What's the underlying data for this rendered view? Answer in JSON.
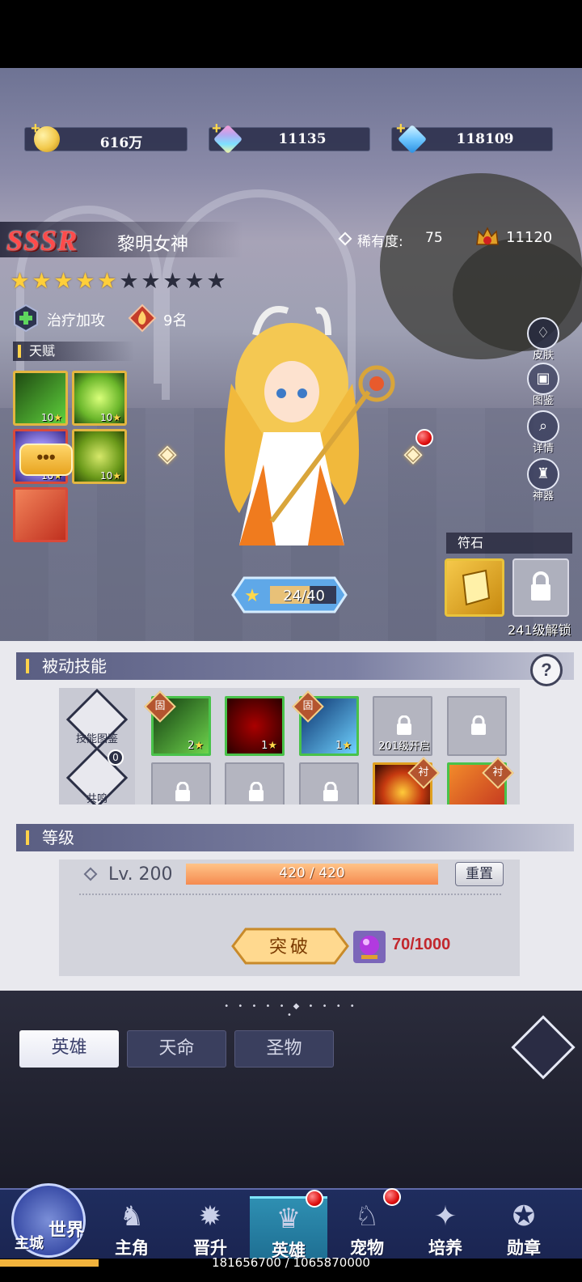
{
  "resources": [
    {
      "name": "gold",
      "value": "616万",
      "color": "#f2c94c"
    },
    {
      "name": "rainbow-diamond",
      "value": "11135",
      "color": "#b9a6f0"
    },
    {
      "name": "blue-diamond",
      "value": "118109",
      "color": "#6fc7ff"
    }
  ],
  "hero": {
    "rarity": "SSSR",
    "name": "黎明女神",
    "rarity_label": "稀有度:",
    "rarity_value": "75",
    "power": "11120",
    "stars_total": 10,
    "stars_filled": 5,
    "type": "治疗加攻",
    "count": "9名"
  },
  "talent": {
    "title": "天赋",
    "items": [
      {
        "level": "10",
        "icon": "green-vine-icon"
      },
      {
        "level": "10",
        "icon": "green-vortex-icon"
      },
      {
        "level": "10",
        "icon": "purple-swirl-icon"
      },
      {
        "level": "10",
        "icon": "green-dragon-icon"
      },
      {
        "level": "",
        "icon": "red-fist-icon"
      }
    ],
    "chat": "•••"
  },
  "side_menu": [
    "皮肤",
    "图鉴",
    "详情",
    "神器"
  ],
  "runes": {
    "title": "符石",
    "unlock": "241级解锁"
  },
  "progress": {
    "text": "24/40",
    "current": 24,
    "max": 40
  },
  "passive": {
    "title": "被动技能",
    "help": "?",
    "left_labels": [
      "技能图鉴",
      "共鸣"
    ],
    "resonance_count": "0",
    "slots": [
      {
        "level": "2",
        "tag": "固",
        "state": "green"
      },
      {
        "level": "1",
        "tag": "",
        "state": "red"
      },
      {
        "level": "1",
        "tag": "固",
        "state": "blue"
      },
      {
        "level": "",
        "tag": "",
        "state": "locked",
        "unlock": "201级开启"
      },
      {
        "level": "",
        "tag": "",
        "state": "locked",
        "unlock": ""
      },
      {
        "level": "",
        "tag": "",
        "state": "locked",
        "unlock": ""
      },
      {
        "level": "",
        "tag": "",
        "state": "locked",
        "unlock": ""
      },
      {
        "level": "",
        "tag": "",
        "state": "locked",
        "unlock": ""
      },
      {
        "level": "",
        "tag": "衬",
        "state": "fire"
      },
      {
        "level": "",
        "tag": "衬",
        "state": "fox"
      }
    ]
  },
  "level": {
    "title": "等级",
    "label": "Lv. 200",
    "xp_text": "420 / 420",
    "xp_fraction": 1.0,
    "reset": "重置",
    "break": "突破",
    "cost": "70/1000"
  },
  "tabs": [
    "英雄",
    "天命",
    "圣物"
  ],
  "nav": {
    "world": "世界",
    "main_city": "主城",
    "items": [
      "主角",
      "晋升",
      "英雄",
      "宠物",
      "培养",
      "勋章"
    ],
    "active_index": 2
  },
  "footer": {
    "text": "181656700 / 1065870000",
    "fraction": 0.17
  }
}
